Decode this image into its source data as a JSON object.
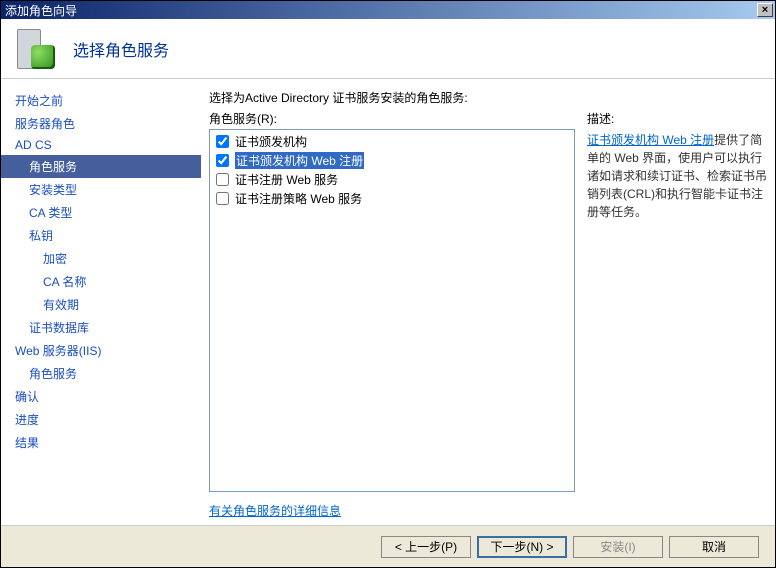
{
  "window": {
    "title": "添加角色向导"
  },
  "header": {
    "heading": "选择角色服务"
  },
  "sidebar": {
    "items": [
      {
        "label": "开始之前",
        "level": 1
      },
      {
        "label": "服务器角色",
        "level": 1
      },
      {
        "label": "AD CS",
        "level": 1
      },
      {
        "label": "角色服务",
        "level": 2,
        "active": true
      },
      {
        "label": "安装类型",
        "level": 2
      },
      {
        "label": "CA 类型",
        "level": 2
      },
      {
        "label": "私钥",
        "level": 2
      },
      {
        "label": "加密",
        "level": 3
      },
      {
        "label": "CA 名称",
        "level": 3
      },
      {
        "label": "有效期",
        "level": 3
      },
      {
        "label": "证书数据库",
        "level": 2
      },
      {
        "label": "Web 服务器(IIS)",
        "level": 1
      },
      {
        "label": "角色服务",
        "level": 2
      },
      {
        "label": "确认",
        "level": 1
      },
      {
        "label": "进度",
        "level": 1
      },
      {
        "label": "结果",
        "level": 1
      }
    ]
  },
  "main": {
    "prompt": "选择为Active Directory 证书服务安装的角色服务:",
    "list_label": "角色服务(R):",
    "options": [
      {
        "label": "证书颁发机构",
        "checked": true,
        "selected": false
      },
      {
        "label": "证书颁发机构 Web 注册",
        "checked": true,
        "selected": true
      },
      {
        "label": "证书注册 Web 服务",
        "checked": false,
        "selected": false
      },
      {
        "label": "证书注册策略 Web 服务",
        "checked": false,
        "selected": false
      }
    ],
    "more_link": "有关角色服务的详细信息"
  },
  "description": {
    "title": "描述:",
    "link_text": "证书颁发机构 Web 注册",
    "body": "提供了简单的 Web 界面，使用户可以执行诸如请求和续订证书、检索证书吊销列表(CRL)和执行智能卡证书注册等任务。"
  },
  "footer": {
    "prev": "< 上一步(P)",
    "next": "下一步(N) >",
    "install": "安装(I)",
    "cancel": "取消"
  }
}
